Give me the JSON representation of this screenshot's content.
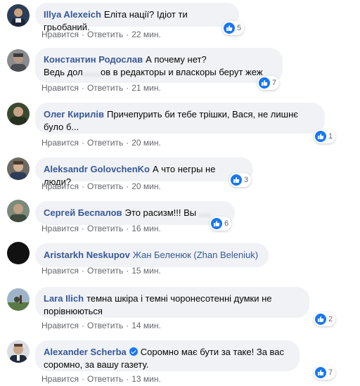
{
  "actions": {
    "like": "Нравится",
    "reply": "Ответить",
    "sep": "·"
  },
  "colors": {
    "name": "#385898",
    "bubble": "#f0f2f5",
    "meta": "#65676b",
    "like_blue": "#1877f2"
  },
  "comments": [
    {
      "author": "Illya Alexeich",
      "text": "Еліта нації? Ідіот ти грьобаний.",
      "time": "22 мин.",
      "likes": "5",
      "verified": false
    },
    {
      "author": "Константин Родослав",
      "text_line1": "А почему нет?",
      "text_line2": "Ведь дол",
      "text_line2b": "ов в редакторы и власкоры берут жеж",
      "time": "21 мин.",
      "likes": "7",
      "verified": false
    },
    {
      "author": "Олег Кирилів",
      "text_line1": "Причепурить би тебе трішки, Вася, не лишнє",
      "text_line2": "було б...",
      "time": "20 мин.",
      "likes": "1",
      "verified": false
    },
    {
      "author": "Aleksandr GolovchenKo",
      "text": "А что негры не люди?",
      "time": "20 мин.",
      "likes": "3",
      "verified": false
    },
    {
      "author": "Сергей Беспалов",
      "text": "Это расизм!!! Вы ",
      "time": "16 мин.",
      "likes": "6",
      "verified": false
    },
    {
      "author": "Aristarkh Neskupov",
      "text": "Жан Беленюк (Zhan Beleniuk)",
      "time": "15 мин.",
      "likes": "",
      "verified": false
    },
    {
      "author": "Lara Ilich",
      "text_line1": "темна шкіра і темні чоронесотенні думки не",
      "text_line2": "порівнюються",
      "time": "14 мин.",
      "likes": "2",
      "verified": false
    },
    {
      "author": "Alexander Scherba",
      "text_line1": "Соромно має бути за таке! За вас",
      "text_line2": "соромно, за вашу газету.",
      "time": "13 мин.",
      "likes": "7",
      "verified": true
    }
  ]
}
